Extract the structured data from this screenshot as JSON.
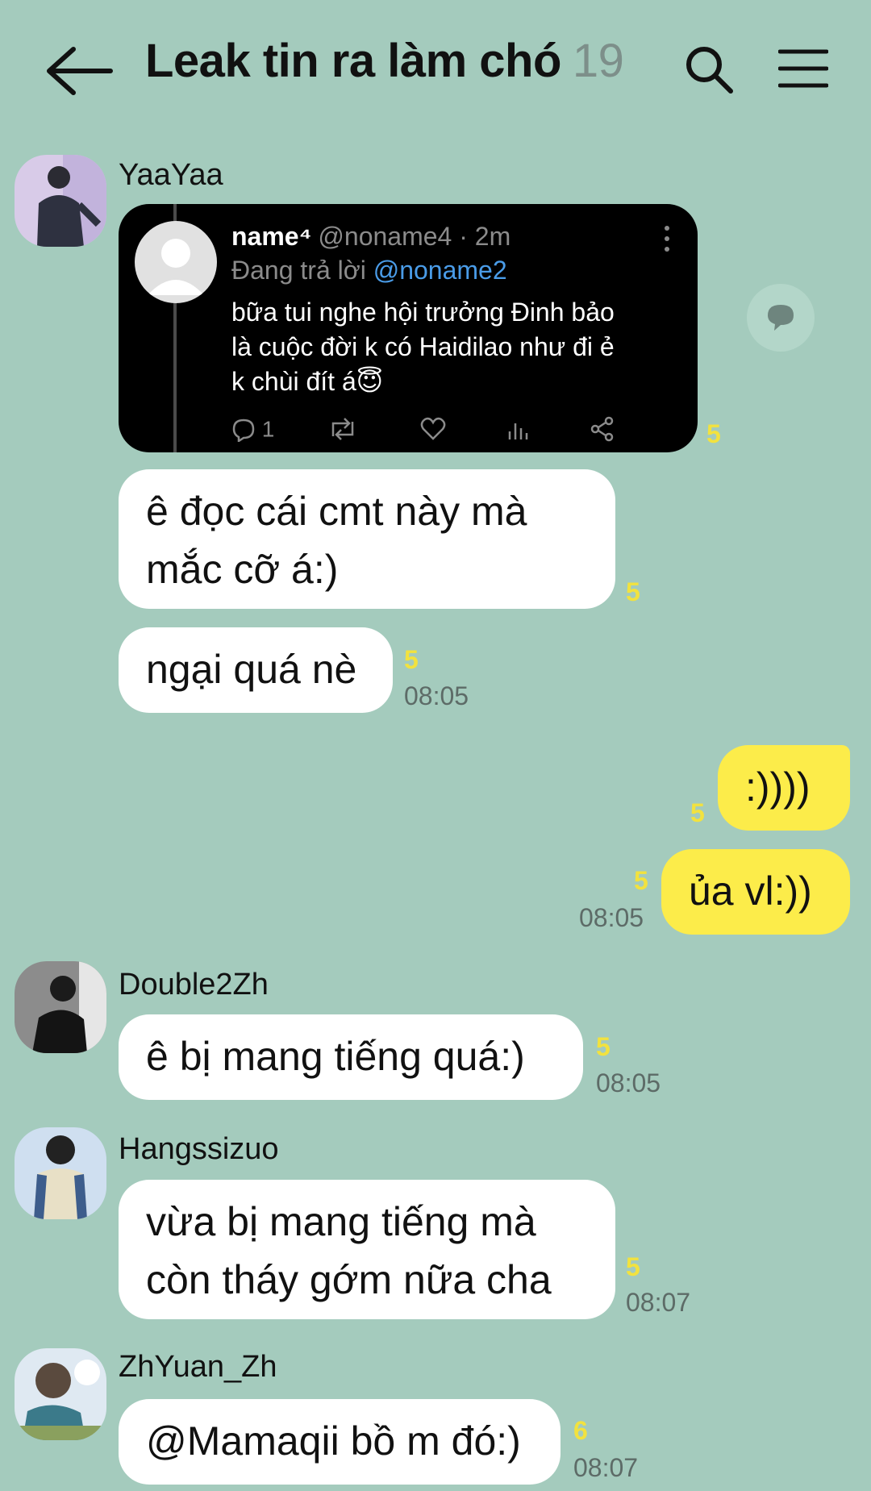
{
  "header": {
    "title": "Leak tin ra làm chó",
    "member_count": "19"
  },
  "tweet": {
    "name": "name⁴",
    "handle": "@noname4 · 2m",
    "reply_prefix": "Đang trả lời",
    "reply_mention": "@noname2",
    "text_lines": [
      "bữa tui nghe hội trưởng Đinh bảo",
      "là cuộc đời k có Haidilao như đi ẻ",
      "k chùi đít á😇"
    ],
    "reply_count": "1"
  },
  "messages": [
    {
      "sender": "YaaYaa",
      "tweet_unread": "5"
    },
    {
      "lines": [
        "ê đọc cái cmt này mà",
        "mắc cỡ á:)"
      ],
      "unread": "5"
    },
    {
      "lines": [
        "ngại quá nè"
      ],
      "unread": "5",
      "time": "08:05"
    },
    {
      "lines": [
        ":))))"
      ],
      "unread": "5"
    },
    {
      "lines": [
        "ủa vl:))"
      ],
      "unread": "5",
      "time": "08:05"
    },
    {
      "sender": "Double2Zh",
      "lines": [
        "ê bị mang tiếng quá:)"
      ],
      "unread": "5",
      "time": "08:05"
    },
    {
      "sender": "Hangssizuo",
      "lines": [
        "vừa bị mang tiếng mà",
        "còn tháy gớm nữa cha"
      ],
      "unread": "5",
      "time": "08:07"
    },
    {
      "sender": "ZhYuan_Zh",
      "lines": [
        "@Mamaqii bồ m đó:)"
      ],
      "unread": "6",
      "time": "08:07"
    }
  ],
  "icons": {
    "back": "arrow-left-icon",
    "search": "search-icon",
    "menu": "hamburger-menu-icon",
    "share": "speech-bubble-icon"
  },
  "colors": {
    "background": "#a4cbbd",
    "my_bubble": "#fcec4a",
    "other_bubble": "#ffffff",
    "unread": "#f2e23f"
  }
}
